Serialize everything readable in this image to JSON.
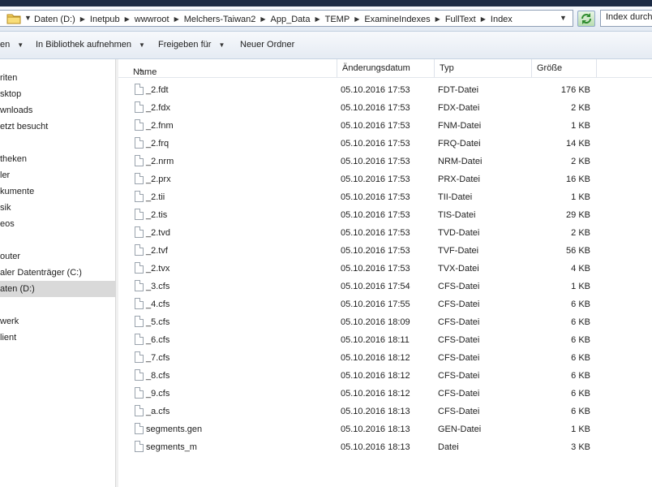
{
  "address": {
    "crumbs": [
      "Daten (D:)",
      "Inetpub",
      "wwwroot",
      "Melchers-Taiwan2",
      "App_Data",
      "TEMP",
      "ExamineIndexes",
      "FullText",
      "Index"
    ],
    "search_placeholder": "Index durchsuchen"
  },
  "toolbar": {
    "organize": "en",
    "library": "In Bibliothek aufnehmen",
    "share": "Freigeben für",
    "new_folder": "Neuer Ordner"
  },
  "nav": {
    "items": [
      {
        "label": "riten",
        "selected": false
      },
      {
        "label": "sktop",
        "selected": false
      },
      {
        "label": "wnloads",
        "selected": false
      },
      {
        "label": "etzt besucht",
        "selected": false
      },
      {
        "label": "theken",
        "selected": false
      },
      {
        "label": "ler",
        "selected": false
      },
      {
        "label": "kumente",
        "selected": false
      },
      {
        "label": "sik",
        "selected": false
      },
      {
        "label": "eos",
        "selected": false
      },
      {
        "label": "outer",
        "selected": false
      },
      {
        "label": "aler Datenträger (C:)",
        "selected": false
      },
      {
        "label": "aten (D:)",
        "selected": true
      },
      {
        "label": "werk",
        "selected": false
      },
      {
        "label": "lient",
        "selected": false
      }
    ]
  },
  "columns": {
    "name": "Name",
    "date": "Änderungsdatum",
    "type": "Typ",
    "size": "Größe"
  },
  "files": [
    {
      "name": "_2.fdt",
      "date": "05.10.2016 17:53",
      "type": "FDT-Datei",
      "size": "176 KB"
    },
    {
      "name": "_2.fdx",
      "date": "05.10.2016 17:53",
      "type": "FDX-Datei",
      "size": "2 KB"
    },
    {
      "name": "_2.fnm",
      "date": "05.10.2016 17:53",
      "type": "FNM-Datei",
      "size": "1 KB"
    },
    {
      "name": "_2.frq",
      "date": "05.10.2016 17:53",
      "type": "FRQ-Datei",
      "size": "14 KB"
    },
    {
      "name": "_2.nrm",
      "date": "05.10.2016 17:53",
      "type": "NRM-Datei",
      "size": "2 KB"
    },
    {
      "name": "_2.prx",
      "date": "05.10.2016 17:53",
      "type": "PRX-Datei",
      "size": "16 KB"
    },
    {
      "name": "_2.tii",
      "date": "05.10.2016 17:53",
      "type": "TII-Datei",
      "size": "1 KB"
    },
    {
      "name": "_2.tis",
      "date": "05.10.2016 17:53",
      "type": "TIS-Datei",
      "size": "29 KB"
    },
    {
      "name": "_2.tvd",
      "date": "05.10.2016 17:53",
      "type": "TVD-Datei",
      "size": "2 KB"
    },
    {
      "name": "_2.tvf",
      "date": "05.10.2016 17:53",
      "type": "TVF-Datei",
      "size": "56 KB"
    },
    {
      "name": "_2.tvx",
      "date": "05.10.2016 17:53",
      "type": "TVX-Datei",
      "size": "4 KB"
    },
    {
      "name": "_3.cfs",
      "date": "05.10.2016 17:54",
      "type": "CFS-Datei",
      "size": "1 KB"
    },
    {
      "name": "_4.cfs",
      "date": "05.10.2016 17:55",
      "type": "CFS-Datei",
      "size": "6 KB"
    },
    {
      "name": "_5.cfs",
      "date": "05.10.2016 18:09",
      "type": "CFS-Datei",
      "size": "6 KB"
    },
    {
      "name": "_6.cfs",
      "date": "05.10.2016 18:11",
      "type": "CFS-Datei",
      "size": "6 KB"
    },
    {
      "name": "_7.cfs",
      "date": "05.10.2016 18:12",
      "type": "CFS-Datei",
      "size": "6 KB"
    },
    {
      "name": "_8.cfs",
      "date": "05.10.2016 18:12",
      "type": "CFS-Datei",
      "size": "6 KB"
    },
    {
      "name": "_9.cfs",
      "date": "05.10.2016 18:12",
      "type": "CFS-Datei",
      "size": "6 KB"
    },
    {
      "name": "_a.cfs",
      "date": "05.10.2016 18:13",
      "type": "CFS-Datei",
      "size": "6 KB"
    },
    {
      "name": "segments.gen",
      "date": "05.10.2016 18:13",
      "type": "GEN-Datei",
      "size": "1 KB"
    },
    {
      "name": "segments_m",
      "date": "05.10.2016 18:13",
      "type": "Datei",
      "size": "3 KB"
    }
  ]
}
